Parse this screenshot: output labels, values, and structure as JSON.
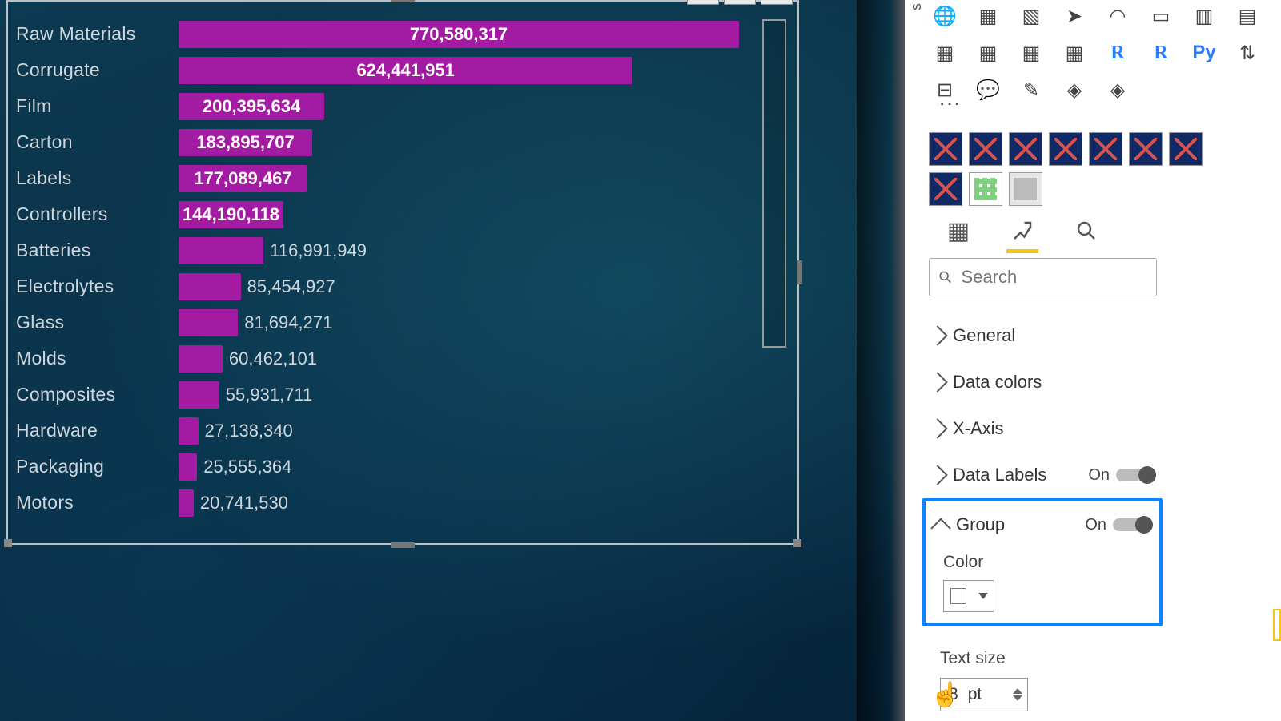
{
  "chart_data": {
    "type": "bar",
    "orientation": "horizontal",
    "categories": [
      "Raw Materials",
      "Corrugate",
      "Film",
      "Carton",
      "Labels",
      "Controllers",
      "Batteries",
      "Electrolytes",
      "Glass",
      "Molds",
      "Composites",
      "Hardware",
      "Packaging",
      "Motors"
    ],
    "values": [
      770580317,
      624441951,
      200395634,
      183895707,
      177089467,
      144190118,
      116991949,
      85454927,
      81694271,
      60462101,
      55931711,
      27138340,
      25555364,
      20741530
    ],
    "value_labels": [
      "770,580,317",
      "624,441,951",
      "200,395,634",
      "183,895,707",
      "177,089,467",
      "144,190,118",
      "116,991,949",
      "85,454,927",
      "81,694,271",
      "60,462,101",
      "55,931,711",
      "27,138,340",
      "25,555,364",
      "20,741,530"
    ],
    "label_inside": [
      true,
      true,
      true,
      true,
      true,
      true,
      false,
      false,
      false,
      false,
      false,
      false,
      false,
      false
    ],
    "bar_color": "#a31aa3"
  },
  "search": {
    "placeholder": "Search"
  },
  "format": {
    "sections": {
      "general": "General",
      "data_colors": "Data colors",
      "x_axis": "X-Axis",
      "data_labels": "Data Labels",
      "group": "Group",
      "color_label": "Color",
      "text_size_label": "Text size"
    },
    "toggles": {
      "data_labels_state": "On",
      "group_state": "On"
    },
    "text_size_value": "8",
    "text_size_unit": "pt",
    "group_color_swatch": "#ffffff"
  },
  "viz_icons": {
    "r_label": "R",
    "r_bold_label": "R",
    "py_label": "Py"
  }
}
